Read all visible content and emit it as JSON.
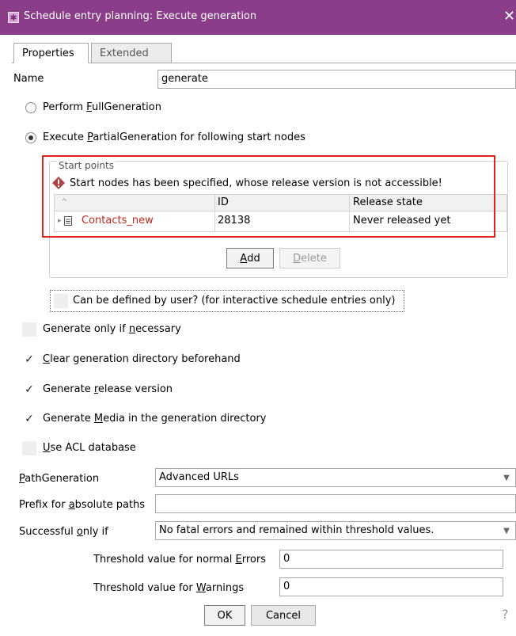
{
  "window": {
    "title": "Schedule entry planning: Execute generation",
    "close_glyph": "✕"
  },
  "tabs": [
    {
      "label": "Properties",
      "active": true
    },
    {
      "label": "Extended",
      "active": false
    }
  ],
  "name": {
    "label": "Name",
    "value": "generate"
  },
  "generation_mode": {
    "full_label": "Perform FullGeneration",
    "full_selected": false,
    "partial_label": "Execute PartialGeneration for following start nodes",
    "partial_selected": true
  },
  "start_points": {
    "legend": "Start points",
    "warning": "Start nodes has been specified, whose release version is not accessible!",
    "columns": [
      "",
      "ID",
      "Release state"
    ],
    "sort_glyph": "^",
    "rows": [
      {
        "name": "Contacts_new",
        "id": "28138",
        "release_state": "Never released yet"
      }
    ],
    "add_label": "Add",
    "delete_label": "Delete"
  },
  "can_be_defined": {
    "label": "Can be defined by user? (for interactive schedule entries only)",
    "checked": false
  },
  "options": [
    {
      "label": "Generate only if necessary",
      "checked": false
    },
    {
      "label": "Clear generation directory beforehand",
      "checked": true
    },
    {
      "label": "Generate release version",
      "checked": true
    },
    {
      "label": "Generate Media in the generation directory",
      "checked": true
    },
    {
      "label": "Use ACL database",
      "checked": false
    }
  ],
  "path_generation": {
    "label": "PathGeneration",
    "value": "Advanced URLs"
  },
  "prefix": {
    "label": "Prefix for absolute paths",
    "value": ""
  },
  "successful_only_if": {
    "label": "Successful only if",
    "value": "No fatal errors and remained within threshold values."
  },
  "threshold_errors": {
    "label": "Threshold value for normal Errors",
    "value": "0"
  },
  "threshold_warnings": {
    "label": "Threshold value for Warnings",
    "value": "0"
  },
  "buttons": {
    "ok": "OK",
    "cancel": "Cancel",
    "help": "?"
  },
  "colors": {
    "titlebar": "#8a3d88",
    "warning_red": "#e0221e",
    "link_red": "#c0281c"
  },
  "icons": {
    "app": "gear-icon",
    "warning": "warning-icon",
    "page": "page-icon"
  }
}
